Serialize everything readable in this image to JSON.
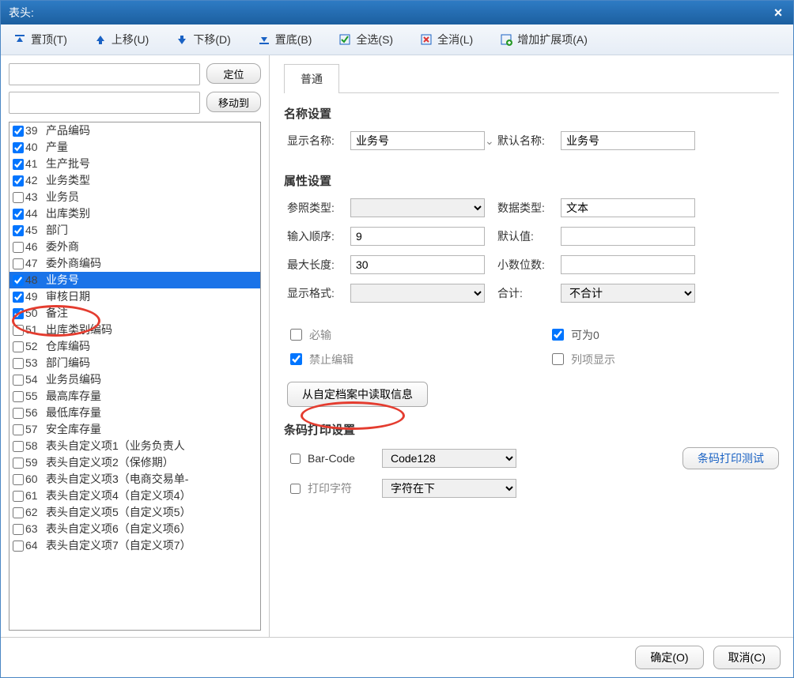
{
  "title": "表头:",
  "toolbar": {
    "top": {
      "label": "置顶(T)"
    },
    "up": {
      "label": "上移(U)"
    },
    "down": {
      "label": "下移(D)"
    },
    "bottom": {
      "label": "置底(B)"
    },
    "all": {
      "label": "全选(S)"
    },
    "none": {
      "label": "全消(L)"
    },
    "addext": {
      "label": "增加扩展项(A)"
    }
  },
  "left": {
    "locate_btn": "定位",
    "moveto_btn": "移动到",
    "items": [
      {
        "checked": true,
        "num": 39,
        "label": "产品编码"
      },
      {
        "checked": true,
        "num": 40,
        "label": "产量"
      },
      {
        "checked": true,
        "num": 41,
        "label": "生产批号"
      },
      {
        "checked": true,
        "num": 42,
        "label": "业务类型"
      },
      {
        "checked": false,
        "num": 43,
        "label": "业务员"
      },
      {
        "checked": true,
        "num": 44,
        "label": "出库类别"
      },
      {
        "checked": true,
        "num": 45,
        "label": "部门"
      },
      {
        "checked": false,
        "num": 46,
        "label": "委外商"
      },
      {
        "checked": false,
        "num": 47,
        "label": "委外商编码"
      },
      {
        "checked": true,
        "num": 48,
        "label": "业务号",
        "selected": true
      },
      {
        "checked": true,
        "num": 49,
        "label": "审核日期"
      },
      {
        "checked": true,
        "num": 50,
        "label": "备注"
      },
      {
        "checked": false,
        "num": 51,
        "label": "出库类别编码"
      },
      {
        "checked": false,
        "num": 52,
        "label": "仓库编码"
      },
      {
        "checked": false,
        "num": 53,
        "label": "部门编码"
      },
      {
        "checked": false,
        "num": 54,
        "label": "业务员编码"
      },
      {
        "checked": false,
        "num": 55,
        "label": "最高库存量"
      },
      {
        "checked": false,
        "num": 56,
        "label": "最低库存量"
      },
      {
        "checked": false,
        "num": 57,
        "label": "安全库存量"
      },
      {
        "checked": false,
        "num": 58,
        "label": "表头自定义项1（业务负责人"
      },
      {
        "checked": false,
        "num": 59,
        "label": "表头自定义项2（保修期）"
      },
      {
        "checked": false,
        "num": 60,
        "label": "表头自定义项3（电商交易单-"
      },
      {
        "checked": false,
        "num": 61,
        "label": "表头自定义项4（自定义项4）"
      },
      {
        "checked": false,
        "num": 62,
        "label": "表头自定义项5（自定义项5）"
      },
      {
        "checked": false,
        "num": 63,
        "label": "表头自定义项6（自定义项6）"
      },
      {
        "checked": false,
        "num": 64,
        "label": "表头自定义项7（自定义项7）"
      }
    ]
  },
  "tabs": {
    "general": "普通"
  },
  "name_section": {
    "title": "名称设置",
    "display_name_label": "显示名称:",
    "display_name_value": "业务号",
    "default_name_label": "默认名称:",
    "default_name_value": "业务号"
  },
  "attr_section": {
    "title": "属性设置",
    "ref_type_label": "参照类型:",
    "ref_type_value": "",
    "data_type_label": "数据类型:",
    "data_type_value": "文本",
    "input_order_label": "输入顺序:",
    "input_order_value": "9",
    "default_value_label": "默认值:",
    "default_value_value": "",
    "max_len_label": "最大长度:",
    "max_len_value": "30",
    "decimals_label": "小数位数:",
    "decimals_value": "",
    "display_format_label": "显示格式:",
    "display_format_value": "",
    "total_label": "合计:",
    "total_value": "不合计"
  },
  "checks": {
    "required": {
      "label": "必输",
      "checked": false
    },
    "allow_zero": {
      "label": "可为0",
      "checked": true
    },
    "lock_edit": {
      "label": "禁止编辑",
      "checked": true
    },
    "column_show": {
      "label": "列项显示",
      "checked": false
    }
  },
  "read_archive_btn": "从自定档案中读取信息",
  "barcode_section": {
    "title": "条码打印设置",
    "barcode_check_label": "Bar-Code",
    "barcode_type_value": "Code128",
    "print_char_label": "打印字符",
    "print_char_value": "字符在下",
    "test_print_btn": "条码打印测试"
  },
  "footer": {
    "ok": "确定(O)",
    "cancel": "取消(C)"
  }
}
